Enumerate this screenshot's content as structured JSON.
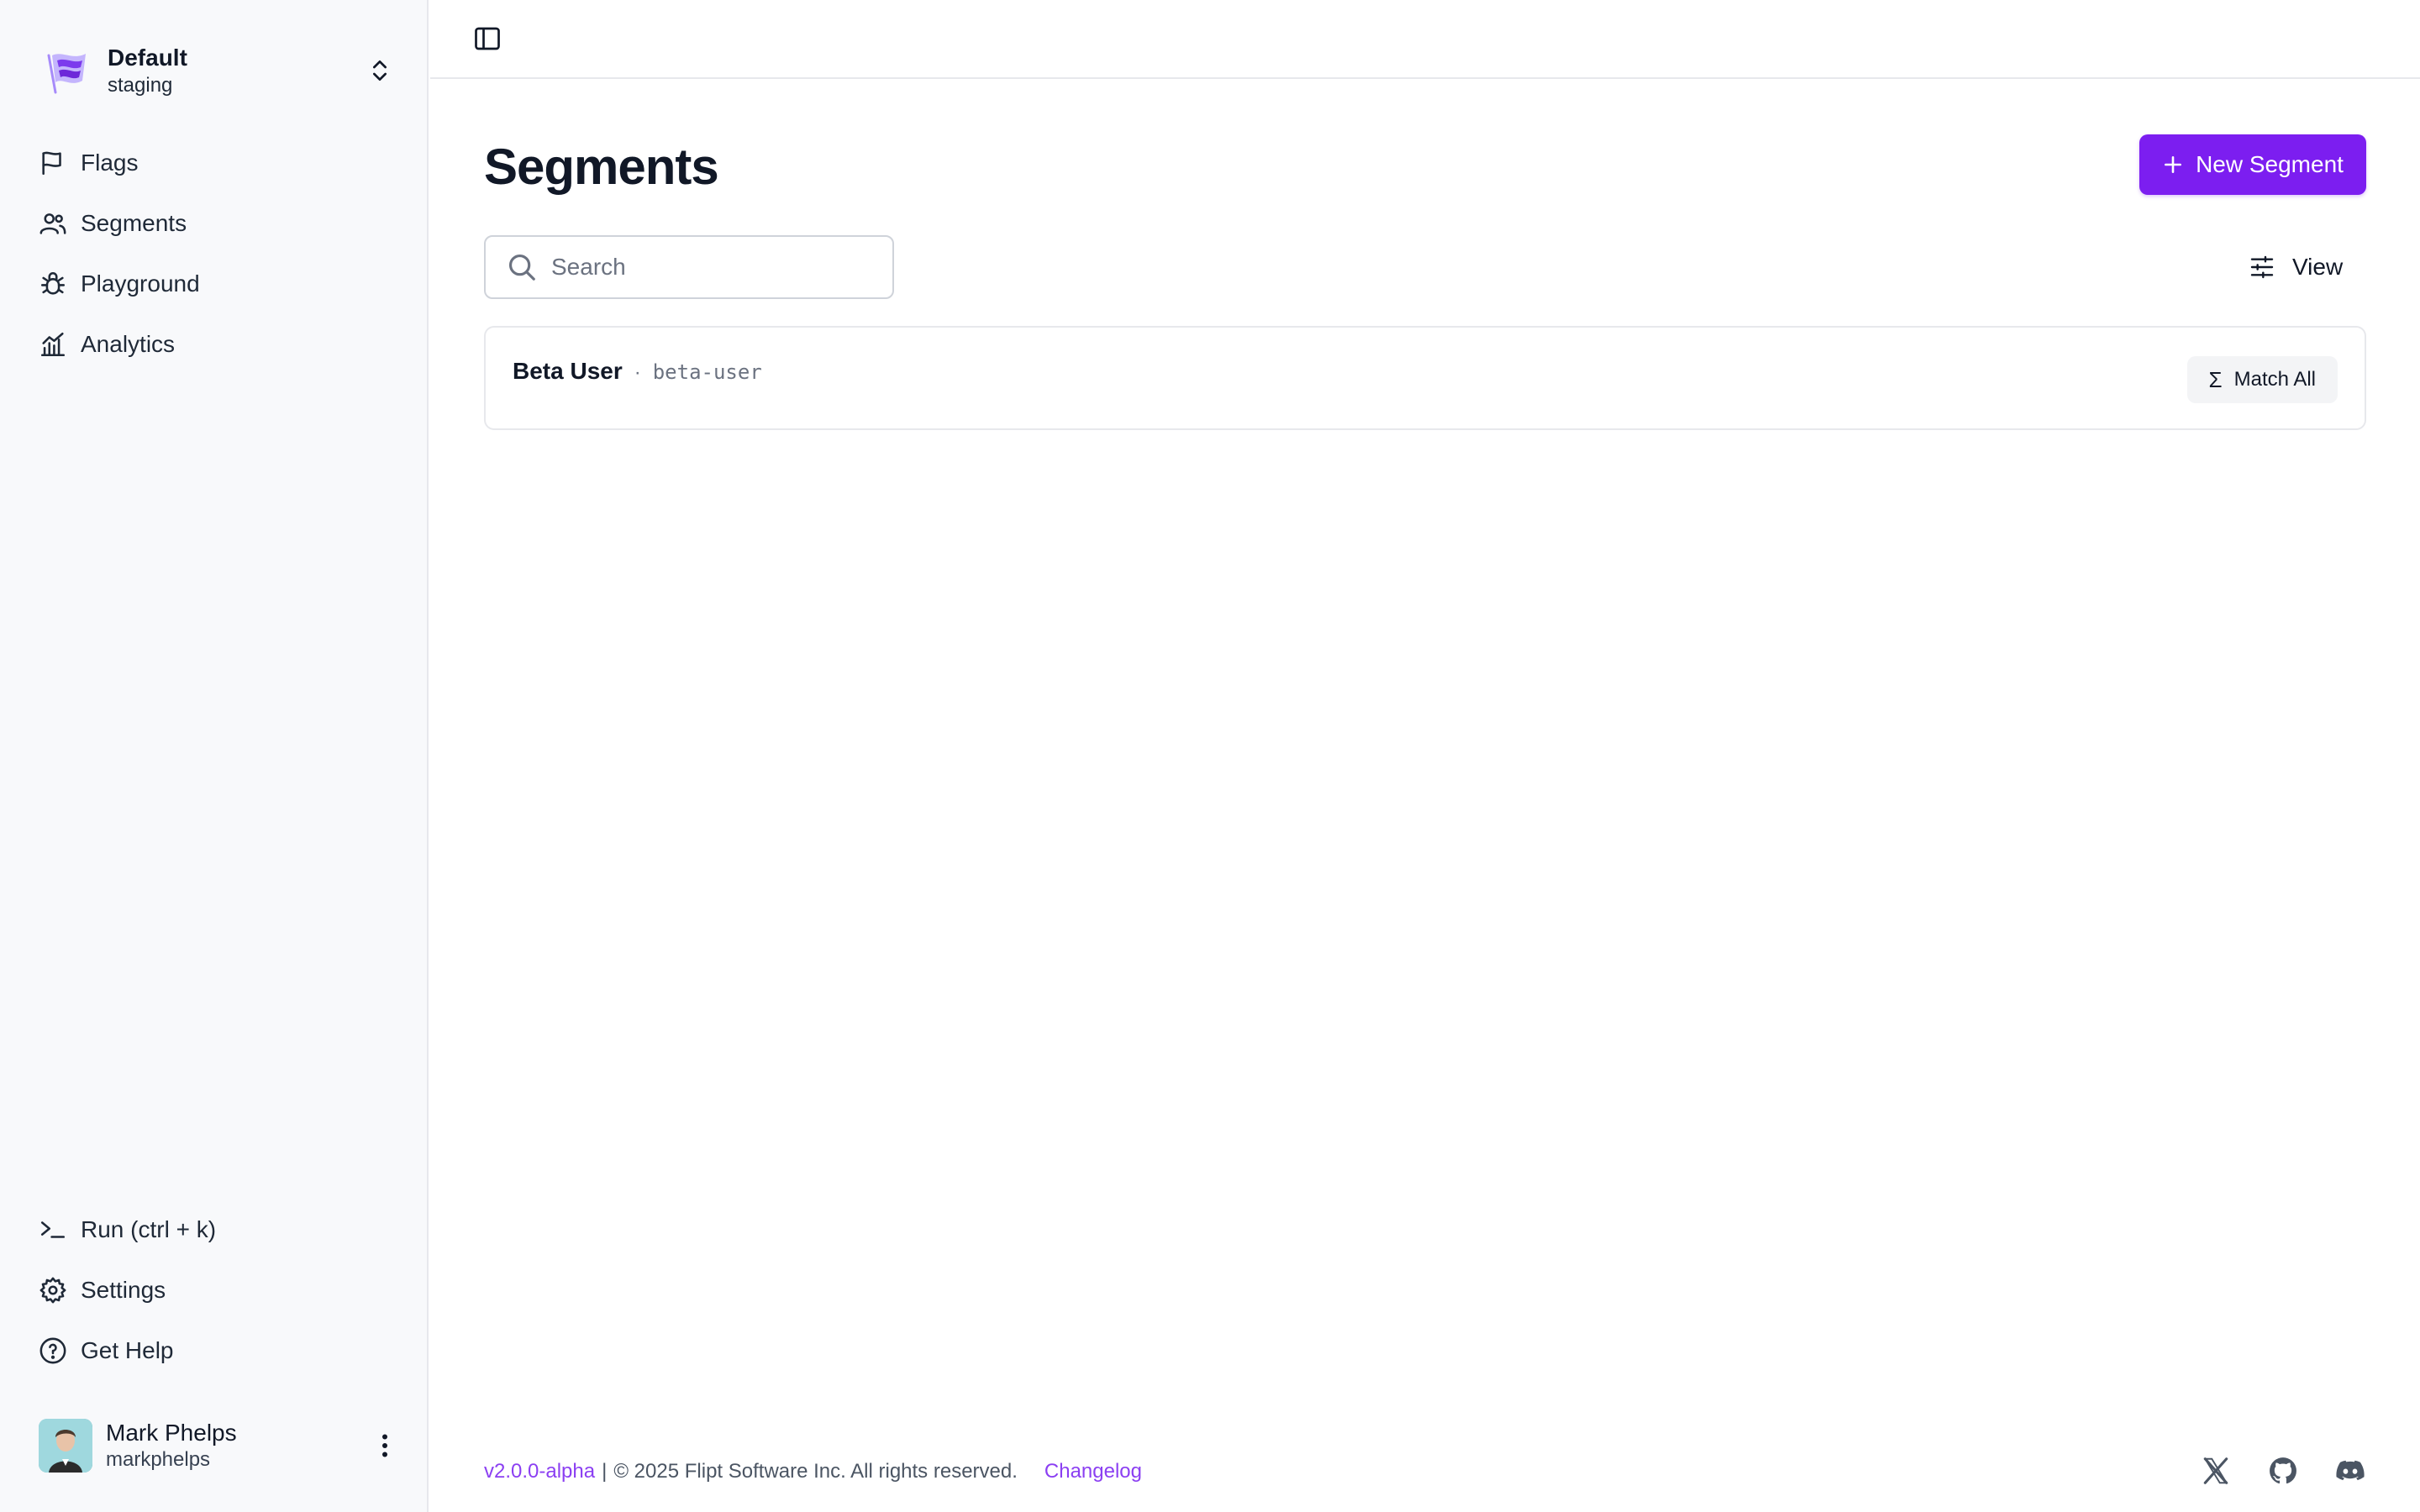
{
  "namespace": {
    "name": "Default",
    "environment": "staging"
  },
  "nav": {
    "items": [
      {
        "label": "Flags",
        "icon": "flag-icon"
      },
      {
        "label": "Segments",
        "icon": "users-icon"
      },
      {
        "label": "Playground",
        "icon": "bug-icon"
      },
      {
        "label": "Analytics",
        "icon": "chart-icon"
      }
    ],
    "bottom": [
      {
        "label": "Run (ctrl + k)",
        "icon": "terminal-icon"
      },
      {
        "label": "Settings",
        "icon": "gear-icon"
      },
      {
        "label": "Get Help",
        "icon": "help-circle-icon"
      }
    ]
  },
  "user": {
    "name": "Mark Phelps",
    "handle": "markphelps"
  },
  "page": {
    "title": "Segments",
    "new_button_label": "New Segment",
    "search_placeholder": "Search",
    "search_value": "",
    "view_label": "View"
  },
  "segments": [
    {
      "name": "Beta User",
      "key": "beta-user",
      "match_type": "Match All"
    }
  ],
  "footer": {
    "version": "v2.0.0-alpha",
    "separator": "|",
    "copyright": "© 2025 Flipt Software Inc. All rights reserved.",
    "changelog": "Changelog"
  },
  "colors": {
    "accent": "#7c1ef0",
    "link": "#8b3ff2",
    "sidebar_bg": "#f8f9fb",
    "border": "#e7e8ec"
  }
}
